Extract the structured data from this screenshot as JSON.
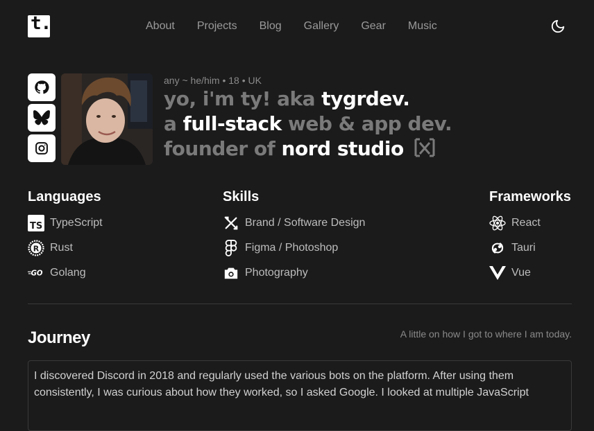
{
  "header": {
    "logo_text": "t.",
    "nav": [
      "About",
      "Projects",
      "Blog",
      "Gallery",
      "Gear",
      "Music"
    ]
  },
  "profile": {
    "meta": "any ~ he/him • 18 • UK",
    "line1_a": "yo, i'm ty! aka ",
    "line1_b": "tygrdev.",
    "line2_a": "a ",
    "line2_b": "full-stack",
    "line2_c": " web & app dev.",
    "line3_a": "founder of ",
    "line3_b": "nord studio"
  },
  "languages": {
    "title": "Languages",
    "items": [
      {
        "label": "TypeScript",
        "icon": "typescript-icon"
      },
      {
        "label": "Rust",
        "icon": "rust-icon"
      },
      {
        "label": "Golang",
        "icon": "golang-icon"
      }
    ]
  },
  "skills": {
    "title": "Skills",
    "items": [
      {
        "label": "Brand / Software Design",
        "icon": "design-tools-icon"
      },
      {
        "label": "Figma / Photoshop",
        "icon": "figma-icon"
      },
      {
        "label": "Photography",
        "icon": "camera-icon"
      }
    ]
  },
  "frameworks": {
    "title": "Frameworks",
    "items": [
      {
        "label": "React",
        "icon": "react-icon"
      },
      {
        "label": "Tauri",
        "icon": "tauri-icon"
      },
      {
        "label": "Vue",
        "icon": "vue-icon"
      }
    ]
  },
  "journey": {
    "title": "Journey",
    "subtitle": "A little on how I got to where I am today.",
    "text": "I discovered Discord in 2018 and regularly used the various bots on the platform. After using them consistently, I was curious about how they worked, so I asked Google. I looked at multiple JavaScript"
  }
}
